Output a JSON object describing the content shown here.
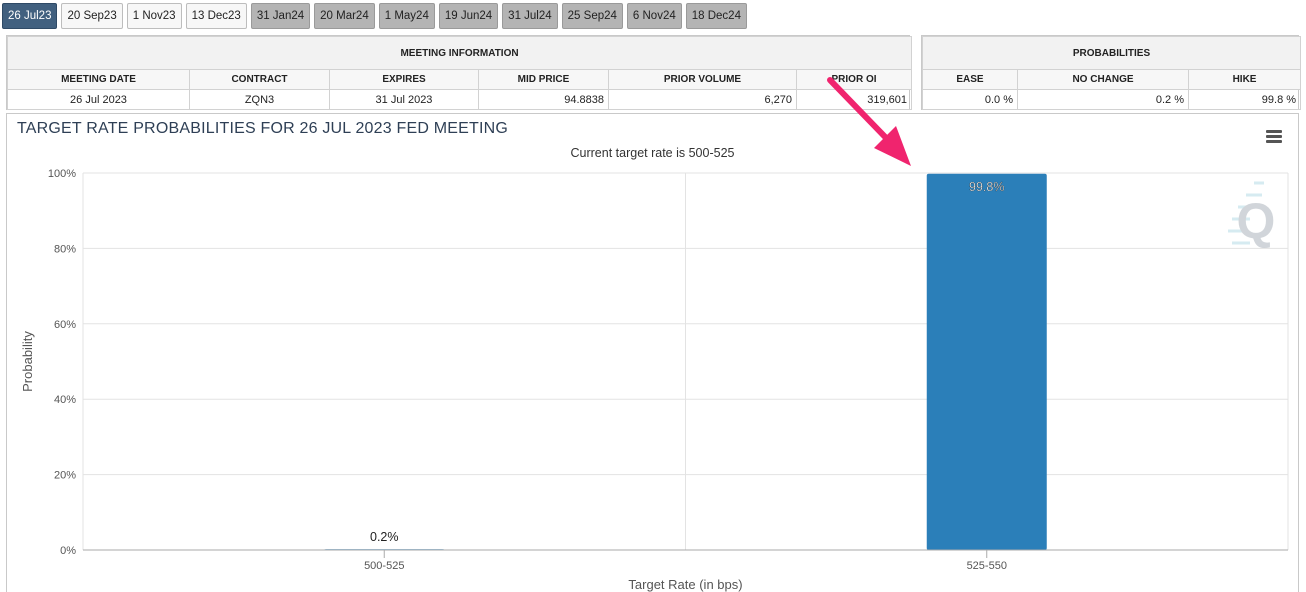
{
  "tabs": [
    {
      "label": "26 Jul23",
      "state": "selected"
    },
    {
      "label": "20 Sep23",
      "state": "light"
    },
    {
      "label": "1 Nov23",
      "state": "light"
    },
    {
      "label": "13 Dec23",
      "state": "light"
    },
    {
      "label": "31 Jan24",
      "state": "dark"
    },
    {
      "label": "20 Mar24",
      "state": "dark"
    },
    {
      "label": "1 May24",
      "state": "dark"
    },
    {
      "label": "19 Jun24",
      "state": "dark"
    },
    {
      "label": "31 Jul24",
      "state": "dark"
    },
    {
      "label": "25 Sep24",
      "state": "dark"
    },
    {
      "label": "6 Nov24",
      "state": "dark"
    },
    {
      "label": "18 Dec24",
      "state": "dark"
    }
  ],
  "meeting_info": {
    "title": "MEETING INFORMATION",
    "columns": [
      "MEETING DATE",
      "CONTRACT",
      "EXPIRES",
      "MID PRICE",
      "PRIOR VOLUME",
      "PRIOR OI"
    ],
    "values": [
      "26 Jul 2023",
      "ZQN3",
      "31 Jul 2023",
      "94.8838",
      "6,270",
      "319,601"
    ]
  },
  "probabilities": {
    "title": "PROBABILITIES",
    "columns": [
      "EASE",
      "NO CHANGE",
      "HIKE"
    ],
    "values": [
      "0.0 %",
      "0.2 %",
      "99.8 %"
    ]
  },
  "chart": {
    "menu_icon": "hamburger-menu-icon",
    "watermark_icon": "q-logo-icon",
    "bar_color": "#2b7fb9",
    "arrow_color": "#f0246e"
  },
  "chart_data": {
    "type": "bar",
    "title": "TARGET RATE PROBABILITIES FOR 26 JUL 2023 FED MEETING",
    "subtitle": "Current target rate is 500-525",
    "xlabel": "Target Rate (in bps)",
    "ylabel": "Probability",
    "categories": [
      "500-525",
      "525-550"
    ],
    "values": [
      0.2,
      99.8
    ],
    "data_labels": [
      "0.2%",
      "99.8%"
    ],
    "ylim": [
      0,
      100
    ],
    "yticks": [
      "0%",
      "20%",
      "40%",
      "60%",
      "80%",
      "100%"
    ],
    "grid": true
  }
}
